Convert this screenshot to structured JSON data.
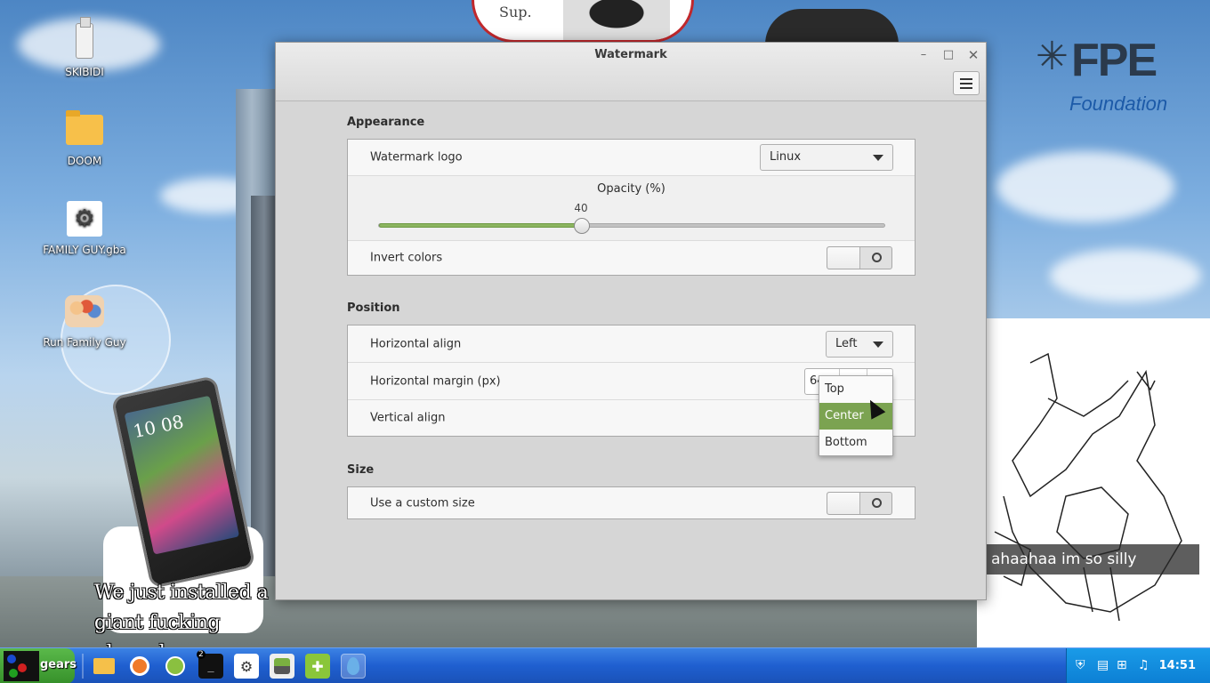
{
  "desktop": {
    "icons": [
      {
        "label": "SKIBIDI",
        "icon": "usb-drive-icon"
      },
      {
        "label": "DOOM",
        "icon": "folder-icon"
      },
      {
        "label": "FAMILY GUY.gba",
        "icon": "gear-file-icon"
      },
      {
        "label": "Run Family Guy",
        "icon": "family-guy-icon"
      }
    ],
    "meme_top_text": "Sup.",
    "phone_clock": "10 08",
    "phone_caption": "We just installed a giant fucking phone here",
    "logo_main": "FPE",
    "logo_sub": "Foundation",
    "drawing_caption": "ahaahaa im so silly"
  },
  "window": {
    "title": "Watermark",
    "controls": {
      "minimize": "–",
      "maximize": "□",
      "close": "✕"
    },
    "sections": {
      "appearance": {
        "title": "Appearance",
        "watermark_logo_label": "Watermark logo",
        "watermark_logo_value": "Linux",
        "opacity_label": "Opacity (%)",
        "opacity_value": 40,
        "opacity_value_text": "40",
        "invert_colors_label": "Invert colors",
        "invert_colors_on": false
      },
      "position": {
        "title": "Position",
        "horizontal_align_label": "Horizontal align",
        "horizontal_align_value": "Left",
        "horizontal_margin_label": "Horizontal margin (px)",
        "horizontal_margin_value": "64",
        "vertical_align_label": "Vertical align"
      },
      "size": {
        "title": "Size",
        "custom_size_label": "Use a custom size",
        "custom_size_on": false
      }
    },
    "vertical_align_popup": {
      "options": [
        "Top",
        "Center",
        "Bottom"
      ],
      "highlighted": "Center"
    }
  },
  "taskbar": {
    "start_label": "gears",
    "terminal_badge": "2",
    "clock": "14:51"
  },
  "colors": {
    "accent": "#7ba351",
    "taskbar": "#1f5fd0",
    "start_button": "#36902a"
  }
}
